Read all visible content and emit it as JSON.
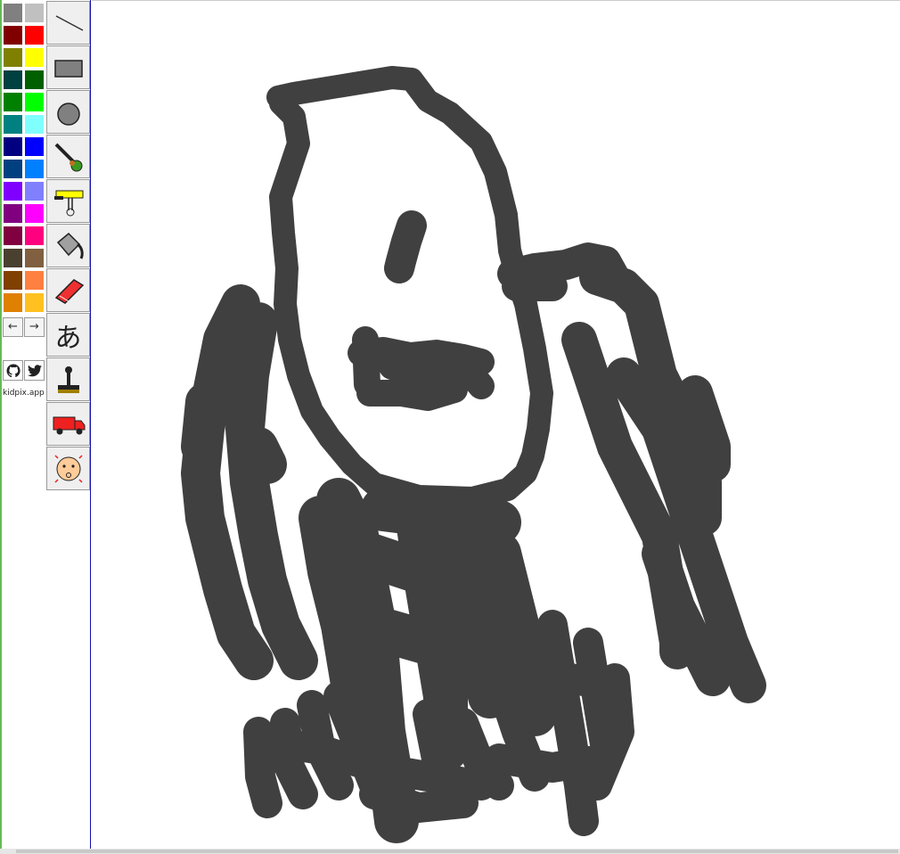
{
  "app": {
    "brand": "kidpix.app"
  },
  "palette": {
    "colors": [
      "#808080",
      "#c0c0c0",
      "#800000",
      "#ff0000",
      "#808000",
      "#ffff00",
      "#004040",
      "#006000",
      "#008000",
      "#00ff00",
      "#008080",
      "#80ffff",
      "#000080",
      "#0000ff",
      "#004080",
      "#0080ff",
      "#8000ff",
      "#8080ff",
      "#800080",
      "#ff00ff",
      "#800040",
      "#ff0080",
      "#4a4030",
      "#806040",
      "#804000",
      "#ff8040",
      "#e08000",
      "#ffc020"
    ],
    "prev_label": "←",
    "next_label": "→"
  },
  "social": {
    "github": "github-icon",
    "twitter": "twitter-icon"
  },
  "tools": [
    {
      "id": "line",
      "icon": "line-icon"
    },
    {
      "id": "rectangle",
      "icon": "rectangle-icon"
    },
    {
      "id": "circle",
      "icon": "circle-icon"
    },
    {
      "id": "brush",
      "icon": "paintbrush-icon"
    },
    {
      "id": "mixer",
      "icon": "mixer-icon"
    },
    {
      "id": "fill",
      "icon": "paint-bucket-icon"
    },
    {
      "id": "eraser",
      "icon": "eraser-icon"
    },
    {
      "id": "text",
      "icon": "text-icon",
      "label": "あ"
    },
    {
      "id": "stamp",
      "icon": "stamp-icon"
    },
    {
      "id": "truck",
      "icon": "truck-icon"
    },
    {
      "id": "face",
      "icon": "face-icon"
    }
  ],
  "drawing": {
    "stroke_color": "#404040"
  }
}
